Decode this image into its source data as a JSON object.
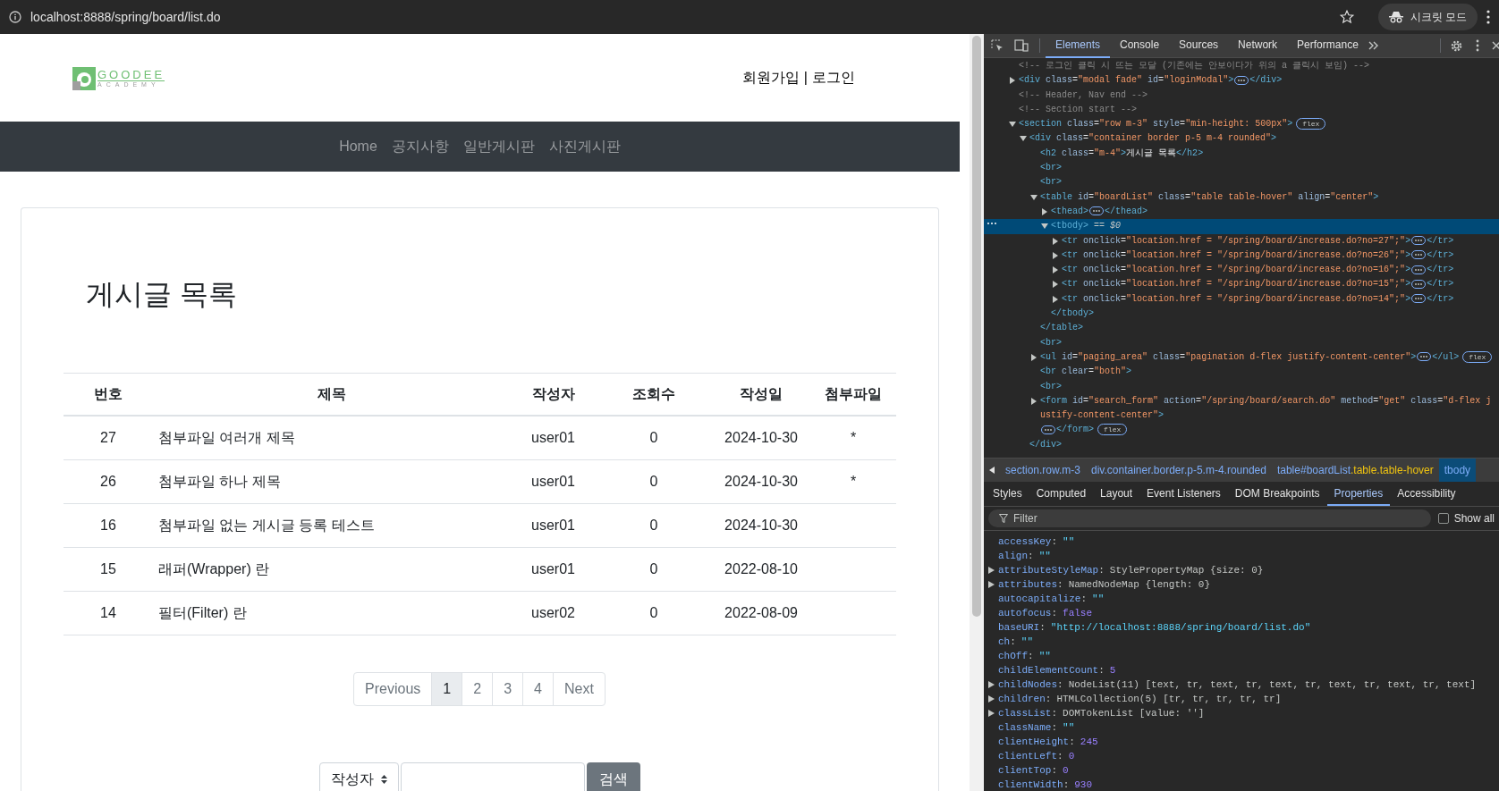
{
  "browser": {
    "url": "localhost:8888/spring/board/list.do",
    "profile_label": "시크릿 모드"
  },
  "page": {
    "logo": {
      "word": "GOODEE",
      "sub": "ACADEMY"
    },
    "auth_links": [
      {
        "label": "회원가입"
      },
      {
        "label": "로그인"
      }
    ],
    "auth_separator": "|",
    "nav": [
      {
        "label": "Home"
      },
      {
        "label": "공지사항"
      },
      {
        "label": "일반게시판"
      },
      {
        "label": "사진게시판"
      }
    ],
    "title": "게시글 목록",
    "table": {
      "columns": [
        "번호",
        "제목",
        "작성자",
        "조회수",
        "작성일",
        "첨부파일"
      ],
      "rows": [
        [
          "27",
          "첨부파일 여러개 제목",
          "user01",
          "0",
          "2024-10-30",
          "*"
        ],
        [
          "26",
          "첨부파일 하나 제목",
          "user01",
          "0",
          "2024-10-30",
          "*"
        ],
        [
          "16",
          "첨부파일 없는 게시글 등록 테스트",
          "user01",
          "0",
          "2024-10-30",
          ""
        ],
        [
          "15",
          "래퍼(Wrapper) 란",
          "user01",
          "0",
          "2022-08-10",
          ""
        ],
        [
          "14",
          "필터(Filter) 란",
          "user02",
          "0",
          "2022-08-09",
          ""
        ]
      ]
    },
    "pagination": [
      {
        "label": "Previous",
        "selected": false
      },
      {
        "label": "1",
        "selected": true
      },
      {
        "label": "2",
        "selected": false
      },
      {
        "label": "3",
        "selected": false
      },
      {
        "label": "4",
        "selected": false
      },
      {
        "label": "Next",
        "selected": false
      }
    ],
    "search": {
      "select": "작성자",
      "button": "검색"
    }
  },
  "devtools": {
    "tabs": [
      {
        "label": "Elements",
        "selected": true
      },
      {
        "label": "Console",
        "selected": false
      },
      {
        "label": "Sources",
        "selected": false
      },
      {
        "label": "Network",
        "selected": false
      },
      {
        "label": "Performance",
        "selected": false
      }
    ],
    "tree": [
      {
        "open": "<!-- 로그인 클릭 시 뜨는 모달 (기존에는 안보이다가 위의 a 클릭시 보임) -->"
      },
      {
        "open": "<div class=\"modal fade\" id=\"loginModal\">",
        "close": "</div>",
        "expanded": false
      },
      {
        "open": "<!-- Header, Nav end -->"
      },
      {
        "open": "<!-- Section start -->"
      },
      {
        "open": "<section class=\"row m-3\" style=\"min-height: 500px\">",
        "badge": "flex",
        "expanded": true,
        "children": [
          {
            "open": "<div class=\"container border p-5 m-4 rounded\">",
            "close": "</div>",
            "expanded": true,
            "children": [
              {
                "open": "<h2 class=\"m-4\">게시글 목록</h2>"
              },
              {
                "open": "<br>"
              },
              {
                "open": "<br>"
              },
              {
                "open": "<table id=\"boardList\" class=\"table table-hover\" align=\"center\">",
                "close": "</table>",
                "expanded": true,
                "children": [
                  {
                    "open": "<thead>",
                    "close": "</thead>",
                    "expanded": false
                  },
                  {
                    "open": "<tbody>",
                    "close": "</tbody>",
                    "expanded": true,
                    "selected": true,
                    "suffix": "== $0",
                    "children": [
                      {
                        "open": "<tr onclick=\"location.href = \"/spring/board/increase.do?no=27\";\">",
                        "close": "</tr>",
                        "expanded": false
                      },
                      {
                        "open": "<tr onclick=\"location.href = \"/spring/board/increase.do?no=26\";\">",
                        "close": "</tr>",
                        "expanded": false
                      },
                      {
                        "open": "<tr onclick=\"location.href = \"/spring/board/increase.do?no=16\";\">",
                        "close": "</tr>",
                        "expanded": false
                      },
                      {
                        "open": "<tr onclick=\"location.href = \"/spring/board/increase.do?no=15\";\">",
                        "close": "</tr>",
                        "expanded": false
                      },
                      {
                        "open": "<tr onclick=\"location.href = \"/spring/board/increase.do?no=14\";\">",
                        "close": "</tr>",
                        "expanded": false
                      }
                    ]
                  }
                ]
              },
              {
                "open": "<br>"
              },
              {
                "open": "<ul id=\"paging_area\" class=\"pagination d-flex justify-content-center\">",
                "close": "</ul>",
                "expanded": false,
                "badge": "flex"
              },
              {
                "open": "<br clear=\"both\">"
              },
              {
                "open": "<br>"
              },
              {
                "open": "<form id=\"search_form\" action=\"/spring/board/search.do\" method=\"get\" class=\"d-flex justify-content-center\">",
                "close": "</form>",
                "expanded": false,
                "badge": "flex"
              }
            ]
          }
        ]
      }
    ],
    "breadcrumbs": [
      {
        "tag": "section.row.m-3",
        "selected": false
      },
      {
        "tag": "div.container.border.p-5.m-4.rounded",
        "selected": false
      },
      {
        "tag": "table#boardList",
        "classes": ".table.table-hover",
        "selected": false
      },
      {
        "tag": "tbody",
        "selected": true
      }
    ],
    "subtabs": [
      {
        "label": "Styles",
        "selected": false
      },
      {
        "label": "Computed",
        "selected": false
      },
      {
        "label": "Layout",
        "selected": false
      },
      {
        "label": "Event Listeners",
        "selected": false
      },
      {
        "label": "DOM Breakpoints",
        "selected": false
      },
      {
        "label": "Properties",
        "selected": true
      },
      {
        "label": "Accessibility",
        "selected": false
      }
    ],
    "filter": {
      "placeholder": "Filter"
    },
    "property_separator": ":",
    "show_all": {
      "label": "Show all",
      "checked": false
    },
    "properties": [
      {
        "name": "accessKey",
        "value": "\"\"",
        "kind": "string"
      },
      {
        "name": "align",
        "value": "\"\"",
        "kind": "string"
      },
      {
        "name": "attributeStyleMap",
        "value": "StylePropertyMap {size: 0}",
        "kind": "object",
        "expandable": true
      },
      {
        "name": "attributes",
        "value": "NamedNodeMap {length: 0}",
        "kind": "object",
        "expandable": true
      },
      {
        "name": "autocapitalize",
        "value": "\"\"",
        "kind": "string"
      },
      {
        "name": "autofocus",
        "value": "false",
        "kind": "keyword"
      },
      {
        "name": "baseURI",
        "value": "\"http://localhost:8888/spring/board/list.do\"",
        "kind": "string"
      },
      {
        "name": "ch",
        "value": "\"\"",
        "kind": "string"
      },
      {
        "name": "chOff",
        "value": "\"\"",
        "kind": "string"
      },
      {
        "name": "childElementCount",
        "value": "5",
        "kind": "number"
      },
      {
        "name": "childNodes",
        "value": "NodeList(11) [text, tr, text, tr, text, tr, text, tr, text, tr, text]",
        "kind": "object",
        "expandable": true
      },
      {
        "name": "children",
        "value": "HTMLCollection(5) [tr, tr, tr, tr, tr]",
        "kind": "object",
        "expandable": true
      },
      {
        "name": "classList",
        "value": "DOMTokenList [value: '']",
        "kind": "object",
        "expandable": true
      },
      {
        "name": "className",
        "value": "\"\"",
        "kind": "string"
      },
      {
        "name": "clientHeight",
        "value": "245",
        "kind": "number"
      },
      {
        "name": "clientLeft",
        "value": "0",
        "kind": "number"
      },
      {
        "name": "clientTop",
        "value": "0",
        "kind": "number"
      },
      {
        "name": "clientWidth",
        "value": "930",
        "kind": "number"
      }
    ]
  }
}
